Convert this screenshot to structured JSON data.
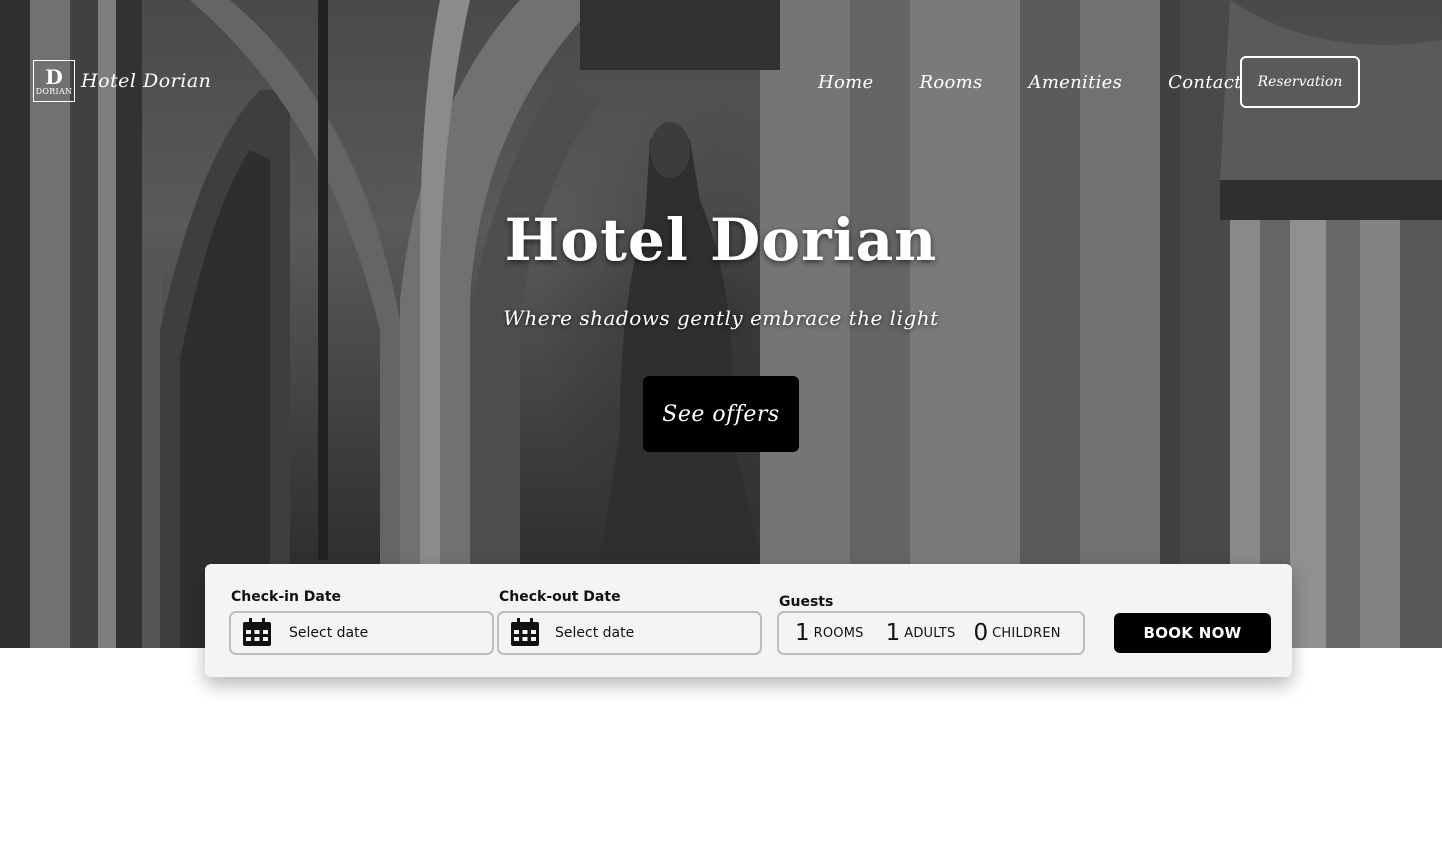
{
  "brand": {
    "logo_letter": "D",
    "logo_small": "DORIAN",
    "name": "Hotel Dorian"
  },
  "nav": {
    "items": [
      "Home",
      "Rooms",
      "Amenities",
      "Contact"
    ],
    "reservation_label": "Reservation"
  },
  "hero": {
    "title": "Hotel Dorian",
    "subtitle": "Where shadows gently embrace the light",
    "cta_label": "See offers"
  },
  "booking": {
    "checkin_label": "Check-in Date",
    "checkin_value": "Select date",
    "checkout_label": "Check-out Date",
    "checkout_value": "Select date",
    "guests_label": "Guests",
    "rooms_count": "1",
    "rooms_label": "ROOMS",
    "adults_count": "1",
    "adults_label": "ADULTS",
    "children_count": "0",
    "children_label": "CHILDREN",
    "book_label": "BOOK NOW"
  },
  "icons": {
    "calendar": "calendar-icon"
  },
  "colors": {
    "accent": "#000000",
    "text_light": "#ffffff",
    "panel_bg": "#f4f4f4",
    "field_border": "#bdbdbd"
  }
}
